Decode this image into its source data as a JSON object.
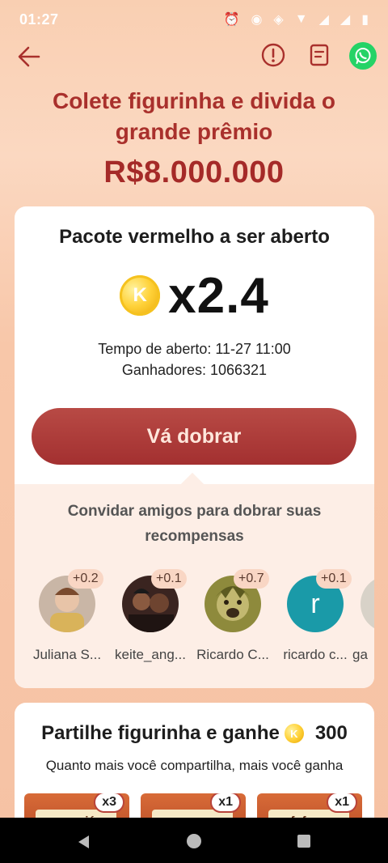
{
  "status": {
    "time": "01:27"
  },
  "header": {
    "headline_line1": "Colete figurinha e divida o",
    "headline_line2": "grande prêmio",
    "prize": "R$8.000.000"
  },
  "packet": {
    "title": "Pacote vermelho a ser aberto",
    "coin_letter": "K",
    "multiplier": "x2.4",
    "open_time": "Tempo de aberto: 11-27 11:00",
    "winners": "Ganhadores: 1066321",
    "double_button": "Vá dobrar"
  },
  "invite": {
    "line1": "Convidar amigos para dobrar suas",
    "line2": "recompensas",
    "friends": [
      {
        "name": "Juliana S...",
        "bonus": "+0.2"
      },
      {
        "name": "keite_ang...",
        "bonus": "+0.1"
      },
      {
        "name": "Ricardo C...",
        "bonus": "+0.7"
      },
      {
        "name": "ricardo c...",
        "bonus": "+0.1",
        "initial": "r"
      },
      {
        "name": "ga",
        "bonus": ""
      }
    ]
  },
  "share": {
    "title": "Partilhe figurinha e ganhe",
    "coin_letter": "K",
    "amount": "300",
    "subtitle": "Quanto mais você compartilha, mais você ganha",
    "stickers": [
      {
        "label": "pacoiá",
        "count": "x3"
      },
      {
        "label": "papo",
        "count": "x1"
      },
      {
        "label": "fofoca",
        "count": "x1"
      }
    ]
  },
  "colors": {
    "accent_red": "#a9302c",
    "button_red": "#a33030",
    "whatsapp_green": "#25d366",
    "background_peach": "#f7c9ab"
  }
}
